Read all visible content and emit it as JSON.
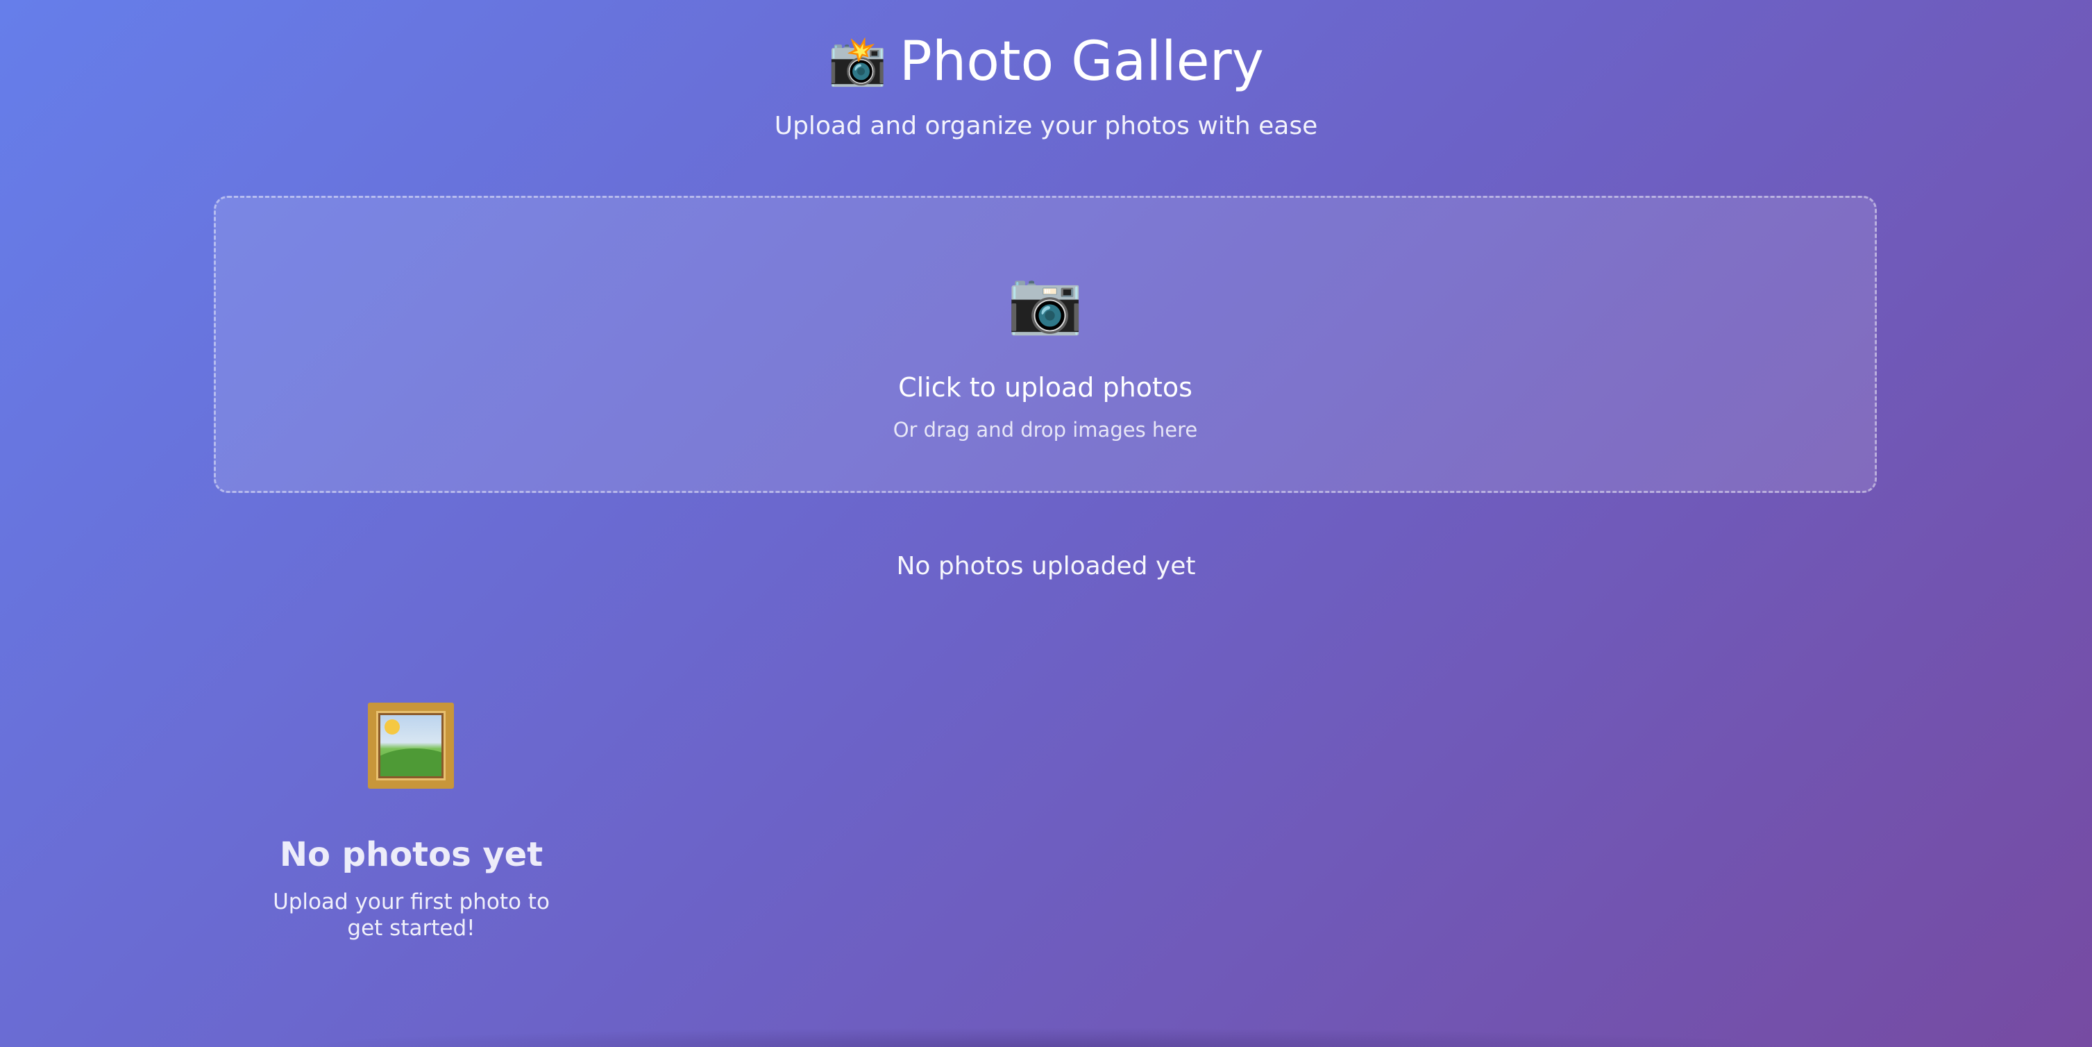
{
  "header": {
    "title_icon": "camera-flash-icon",
    "title_icon_glyph": "📸",
    "title": "Photo Gallery",
    "subtitle": "Upload and organize your photos with ease"
  },
  "upload": {
    "icon": "camera-icon",
    "icon_glyph": "📷",
    "title": "Click to upload photos",
    "hint": "Or drag and drop images here"
  },
  "gallery": {
    "count_text": "No photos uploaded yet",
    "empty": {
      "icon": "framed-picture-icon",
      "title": "No photos yet",
      "text": "Upload your first photo to get started!"
    }
  },
  "colors": {
    "gradient_start": "#667eea",
    "gradient_end": "#764ba2",
    "text": "#ffffff"
  }
}
